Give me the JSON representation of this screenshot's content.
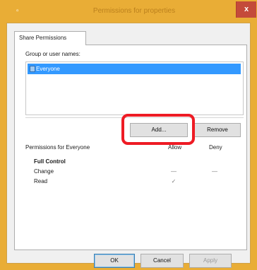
{
  "window": {
    "title": "Permissions for properties",
    "close_label": "x",
    "colors": {
      "frame": "#e9ad36",
      "close": "#c44a3a",
      "selection": "#3399ff",
      "highlight_ring": "#ee1b24"
    }
  },
  "tabs": [
    {
      "label": "Share Permissions"
    }
  ],
  "groups": {
    "label": "Group or user names:",
    "items": [
      {
        "name": "Everyone",
        "icon": "users-icon",
        "selected": true
      }
    ]
  },
  "buttons": {
    "add": "Add...",
    "remove": "Remove"
  },
  "permissions": {
    "header": "Permissions for Everyone",
    "allow_header": "Allow",
    "deny_header": "Deny",
    "rows": [
      {
        "name": "Full Control",
        "allow": "",
        "deny": ""
      },
      {
        "name": "Change",
        "allow": "—",
        "deny": "—"
      },
      {
        "name": "Read",
        "allow": "✓",
        "deny": ""
      }
    ]
  },
  "footer": {
    "ok": "OK",
    "cancel": "Cancel",
    "apply": "Apply"
  }
}
